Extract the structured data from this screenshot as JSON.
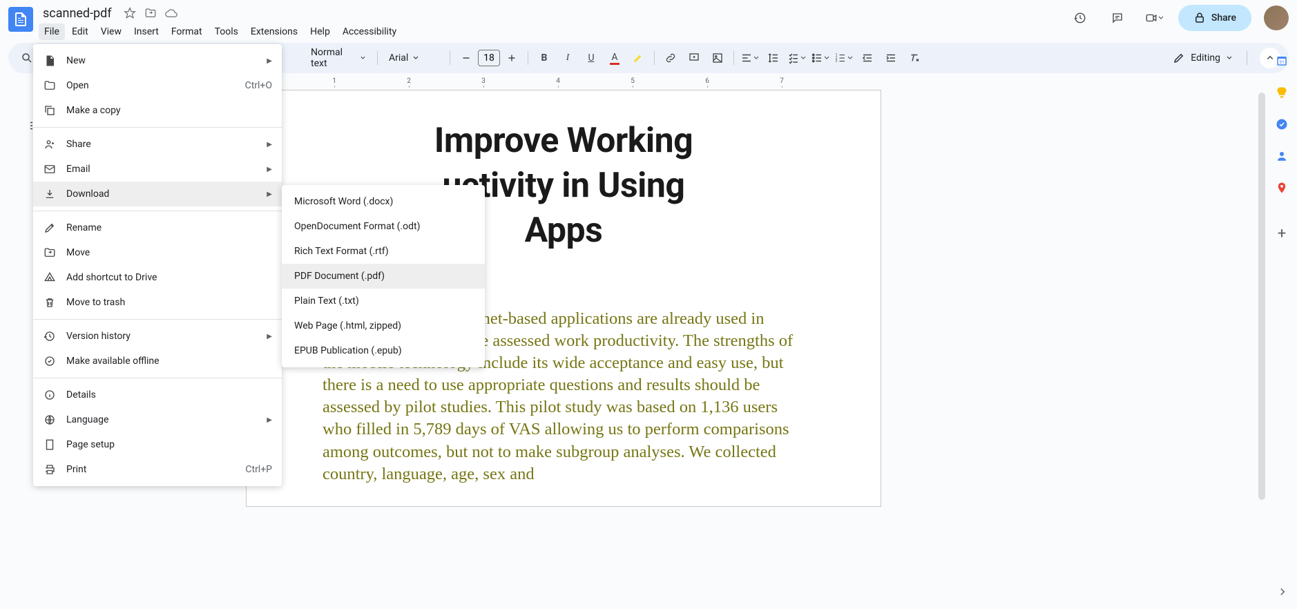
{
  "doc": {
    "title": "scanned-pdf"
  },
  "menubar": [
    "File",
    "Edit",
    "View",
    "Insert",
    "Format",
    "Tools",
    "Extensions",
    "Help",
    "Accessibility"
  ],
  "toolbar": {
    "style": "Normal text",
    "font": "Arial",
    "fontsize": "18",
    "editing": "Editing"
  },
  "share": {
    "label": "Share"
  },
  "fileMenu": {
    "new": "New",
    "open": "Open",
    "open_sc": "Ctrl+O",
    "copy": "Make a copy",
    "share": "Share",
    "email": "Email",
    "download": "Download",
    "rename": "Rename",
    "move": "Move",
    "shortcut": "Add shortcut to Drive",
    "trash": "Move to trash",
    "version": "Version history",
    "offline": "Make available offline",
    "details": "Details",
    "language": "Language",
    "pagesetup": "Page setup",
    "print": "Print",
    "print_sc": "Ctrl+P"
  },
  "downloadMenu": [
    "Microsoft Word (.docx)",
    "OpenDocument Format (.odt)",
    "Rich Text Format (.rtf)",
    "PDF Document (.pdf)",
    "Plain Text (.txt)",
    "Web Page (.html, zipped)",
    "EPUB Publication (.epub)"
  ],
  "downloadHighlighted": 3,
  "ruler": [
    "1",
    "2",
    "3",
    "4",
    "5",
    "6",
    "7"
  ],
  "document": {
    "heading_line1": "Improve Working",
    "heading_line2": "uctivity in Using",
    "heading_line3": "Apps",
    "body": "Smart devices and internet-based applications are already used in rhinitis (24-29) but none assessed work productivity. The strengths of the mobile technology include its wide acceptance and easy use, but there is a need to use appropriate questions and results should be assessed by pilot studies. This pilot study was based on 1,136 users who filled in 5,789 days of VAS allowing us to perform comparisons among outcomes, but not to make subgroup analyses. We collected country, language, age, sex and"
  }
}
